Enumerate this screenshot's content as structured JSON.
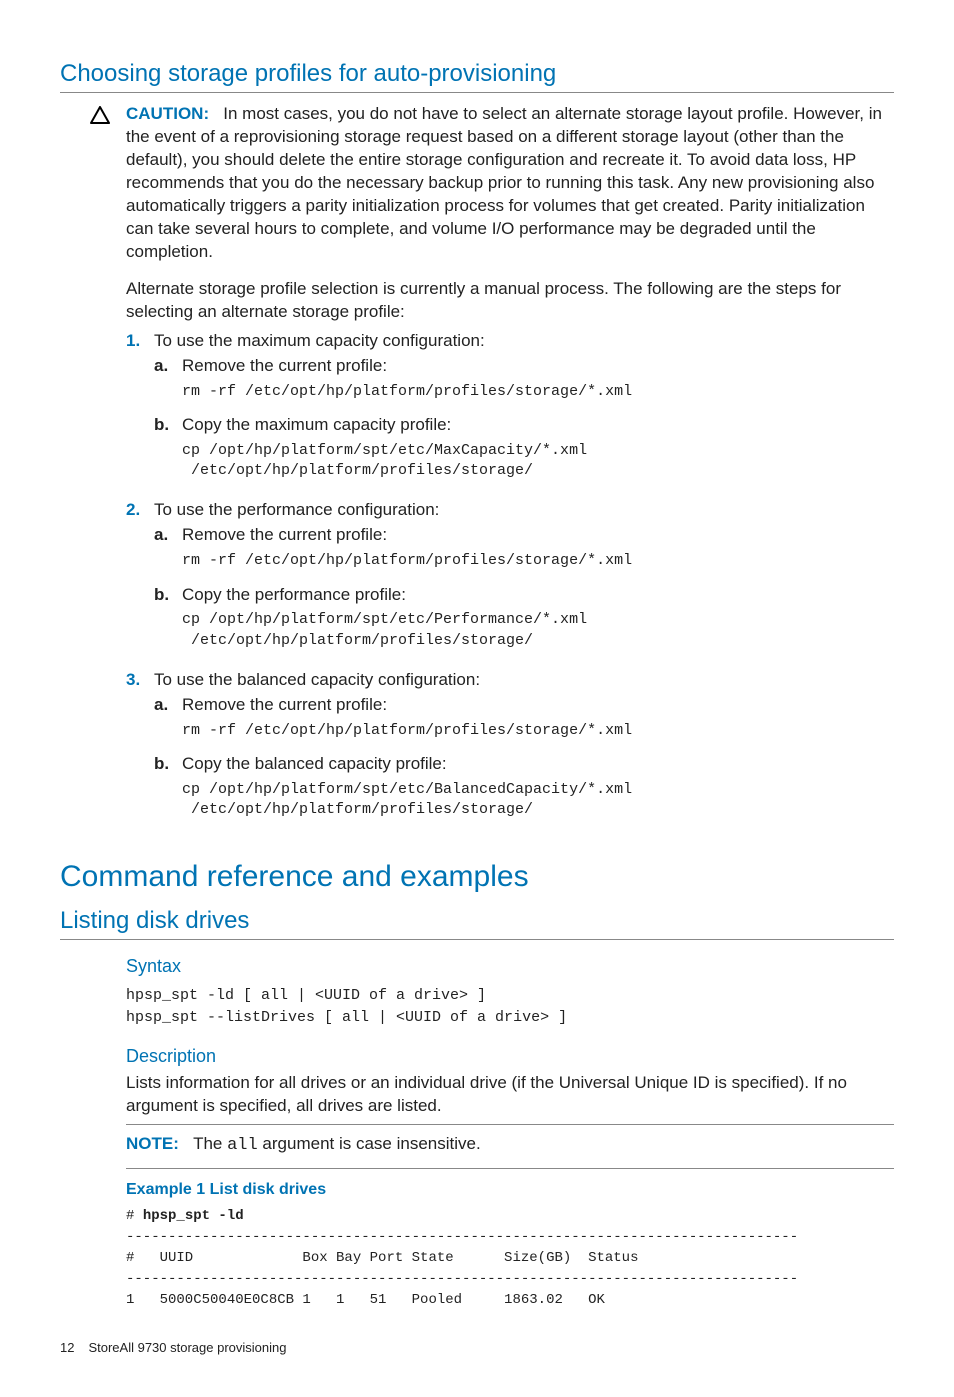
{
  "h2_choosing": "Choosing storage profiles for auto-provisioning",
  "caution_label": "CAUTION:",
  "caution_text": "In most cases, you do not have to select an alternate storage layout profile. However, in the event of a reprovisioning storage request based on a different storage layout (other than the default), you should delete the entire storage configuration and recreate it. To avoid data loss, HP recommends that you do the necessary backup prior to running this task. Any new provisioning also automatically triggers a parity initialization process for volumes that get created. Parity initialization can take several hours to complete, and volume I/O performance may be degraded until the completion.",
  "intro_para": "Alternate storage profile selection is currently a manual process. The following are the steps for selecting an alternate storage profile:",
  "steps": [
    {
      "marker": "1.",
      "text": "To use the maximum capacity configuration:",
      "sub": [
        {
          "m": "a.",
          "t": "Remove the current profile:",
          "cmd": "rm -rf /etc/opt/hp/platform/profiles/storage/*.xml"
        },
        {
          "m": "b.",
          "t": "Copy the maximum capacity profile:",
          "cmd": "cp /opt/hp/platform/spt/etc/MaxCapacity/*.xml\n /etc/opt/hp/platform/profiles/storage/"
        }
      ]
    },
    {
      "marker": "2.",
      "text": "To use the performance configuration:",
      "sub": [
        {
          "m": "a.",
          "t": "Remove the current profile:",
          "cmd": "rm -rf /etc/opt/hp/platform/profiles/storage/*.xml"
        },
        {
          "m": "b.",
          "t": "Copy the performance profile:",
          "cmd": "cp /opt/hp/platform/spt/etc/Performance/*.xml\n /etc/opt/hp/platform/profiles/storage/"
        }
      ]
    },
    {
      "marker": "3.",
      "text": "To use the balanced capacity configuration:",
      "sub": [
        {
          "m": "a.",
          "t": "Remove the current profile:",
          "cmd": "rm -rf /etc/opt/hp/platform/profiles/storage/*.xml"
        },
        {
          "m": "b.",
          "t": "Copy the balanced capacity profile:",
          "cmd": "cp /opt/hp/platform/spt/etc/BalancedCapacity/*.xml\n /etc/opt/hp/platform/profiles/storage/"
        }
      ]
    }
  ],
  "h1_cmdref": "Command reference and examples",
  "h2_listing": "Listing disk drives",
  "syntax_label": "Syntax",
  "syntax_block": "hpsp_spt -ld [ all | <UUID of a drive> ]\nhpsp_spt --listDrives [ all | <UUID of a drive> ]",
  "desc_label": "Description",
  "desc_text": "Lists information for all drives or an individual drive (if the Universal Unique ID is specified). If no argument is specified, all drives are listed.",
  "note_label": "NOTE:",
  "note_prefix": "The ",
  "note_code": "all",
  "note_suffix": " argument is case insensitive.",
  "example_title": "Example 1 List disk drives",
  "example_prompt": "# ",
  "example_cmd": "hpsp_spt -ld",
  "example_output": "--------------------------------------------------------------------------------\n#   UUID             Box Bay Port State      Size(GB)  Status\n--------------------------------------------------------------------------------\n1   5000C50040E0C8CB 1   1   51   Pooled     1863.02   OK",
  "footer_page": "12",
  "footer_text": "StoreAll 9730 storage provisioning"
}
